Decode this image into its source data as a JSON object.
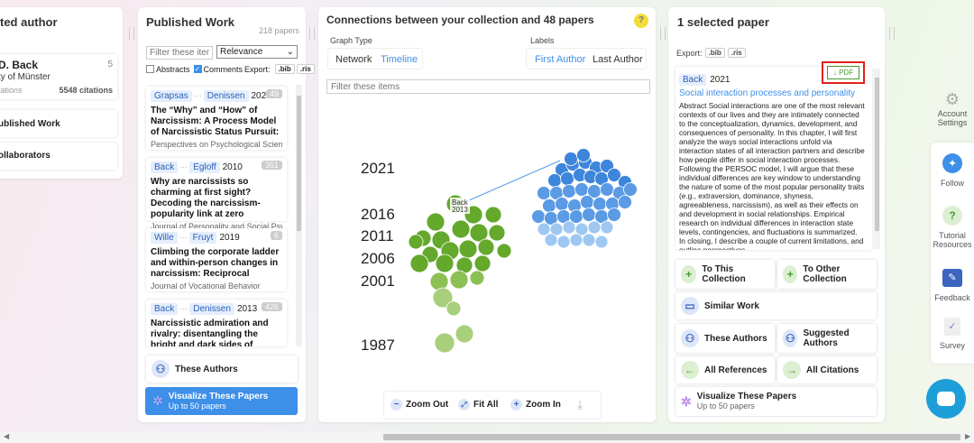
{
  "left_panel": {
    "title": "ted author",
    "author_name": "D. Back",
    "author_count": "5",
    "affiliation": "ty of Münster",
    "citations_label": "tations",
    "citations_total": "5548 citations",
    "nav_published": "ublished Work",
    "nav_collaborators": "ollaborators"
  },
  "published": {
    "title": "Published Work",
    "count": "218 papers",
    "filter_placeholder": "Filter these item",
    "sort_selected": "Relevance",
    "abstracts_label": "Abstracts",
    "comments_label": "Comments",
    "export_label": "Export:",
    "bib": ".bib",
    "ris": ".ris",
    "papers": [
      {
        "a1": "Grapsas",
        "a2": "Denissen",
        "year": "2020",
        "count": "49",
        "title": "The “Why” and “How” of Narcissism: A Process Model of Narcissistic Status Pursuit:",
        "journal": "Perspectives on Psychological Science"
      },
      {
        "a1": "Back",
        "a2": "Egloff",
        "year": "2010",
        "count": "351",
        "title": "Why are narcissists so charming at first sight? Decoding the narcissism-popularity link at zero",
        "journal": "Journal of Personality and Social Psycho"
      },
      {
        "a1": "Wille",
        "a2": "Fruyt",
        "year": "2019",
        "count": "6",
        "title": "Climbing the corporate ladder and within-person changes in narcissism: Reciprocal",
        "journal": "Journal of Vocational Behavior"
      },
      {
        "a1": "Back",
        "a2": "Denissen",
        "year": "2013",
        "count": "426",
        "title": "Narcissistic admiration and rivalry: disentangling the bright and dark sides of narcissism.",
        "journal": ""
      }
    ],
    "these_authors": "These Authors",
    "visualize": "Visualize These Papers",
    "visualize_sub": "Up to 50 papers"
  },
  "graph": {
    "title": "Connections between your collection and 48 papers",
    "help": "?",
    "graph_type_label": "Graph Type",
    "network": "Network",
    "timeline": "Timeline",
    "labels_label": "Labels",
    "first_author": "First Author",
    "last_author": "Last Author",
    "filter_placeholder": "Filter these items",
    "years": [
      "2021",
      "2016",
      "2011",
      "2006",
      "2001",
      "1987"
    ],
    "node_label_a": "Back",
    "node_label_b": "2013",
    "zoom_out": "Zoom Out",
    "fit_all": "Fit All",
    "zoom_in": "Zoom In"
  },
  "selected": {
    "title": "1 selected paper",
    "export_label": "Export:",
    "bib": ".bib",
    "ris": ".ris",
    "pdf": "↓ PDF",
    "author": "Back",
    "year": "2021",
    "paper_title": "Social interaction processes and personality",
    "abstract": "Abstract Social interactions are one of the most relevant contexts of our lives and they are intimately connected to the conceptualization, dynamics, development, and consequences of personality. In this chapter, I will first analyze the ways social interactions unfold via interaction states of all interaction partners and describe how people differ in social interaction processes. Following the PERSOC model, I will argue that these individual differences are key window to understanding the nature of some of the most popular personality traits (e.g., extraversion, dominance, shyness, agreeableness, narcissism), as well as their effects on and development in social relationships. Empirical research on individual differences in interaction state levels, contingencies, and fluctuations is summarized. In closing, I describe a couple of current limitations, and outline perspectives",
    "actions": {
      "to_this": "To This Collection",
      "to_other": "To Other Collection",
      "similar": "Similar Work",
      "these_authors": "These Authors",
      "suggested": "Suggested Authors",
      "all_refs": "All References",
      "all_cites": "All Citations",
      "visualize": "Visualize These Papers",
      "visualize_sub": "Up to 50 papers"
    }
  },
  "sidebar": {
    "account": "Account Settings",
    "follow": "Follow",
    "tutorial": "Tutorial Resources",
    "feedback": "Feedback",
    "survey": "Survey"
  },
  "colors": {
    "accent": "#3d8fe8",
    "green": "#6aae3a",
    "highlight_box": "#e02020"
  }
}
